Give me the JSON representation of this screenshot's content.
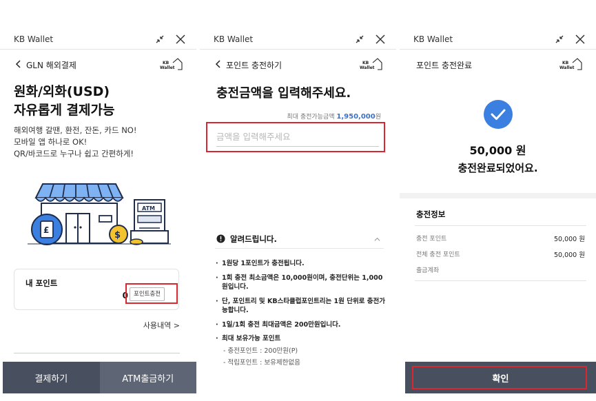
{
  "panel1": {
    "app_title": "KB Wallet",
    "nav_label": "GLN 해외결제",
    "logo_text": [
      "KB",
      "Wallet"
    ],
    "hero_title": [
      "원화/외화(USD)",
      "자유롭게 결제가능"
    ],
    "hero_sub": [
      "해외여행 갈땐, 환전, 잔돈, 카드 NO!",
      "모바일 앱 하나로 OK!",
      "QR/바코드로 누구나 쉽고 간편하게!"
    ],
    "illustration": {
      "atm_label": "ATM",
      "coin_symbol": "$",
      "card_symbol": "£"
    },
    "points_label": "내 포인트",
    "points_value": "0 P",
    "charge_button": "포인트충전",
    "history_link": "사용내역 >",
    "bottom_buttons": {
      "pay": "결제하기",
      "atm": "ATM출금하기"
    }
  },
  "panel2": {
    "app_title": "KB Wallet",
    "nav_label": "포인트 충전하기",
    "title": "충전금액을 입력해주세요.",
    "max_label": "최대 충전가능금액",
    "max_value": "1,950,000",
    "max_unit": "원",
    "amount_placeholder": "금액을 입력해주세요",
    "notice_title": "알려드립니다.",
    "notices": [
      "1원당 1포인트가 충전됩니다.",
      "1회 충전 최소금액은 10,000원이며, 충전단위는 1,000원입니다.",
      "단, 포인트리 및 KB스타클럽포인트리는 1원 단위로 충전가능합니다.",
      "1일/1회 충전 최대금액은 200만원입니다.",
      "최대 보유가능 포인트"
    ],
    "notice_subs": [
      "- 충전포인트 : 200만원(P)",
      "- 적립포인트 : 보유제한없음"
    ]
  },
  "panel3": {
    "app_title": "KB Wallet",
    "nav_label": "포인트 충전완료",
    "amount": "50,000 원",
    "message": "충전완료되었어요.",
    "info_title": "충전정보",
    "info_rows": [
      {
        "label": "충전 포인트",
        "value": "50,000 원"
      },
      {
        "label": "전체 충전 포인트",
        "value": "50,000 원"
      },
      {
        "label": "출금계좌",
        "value": ""
      }
    ],
    "confirm": "확인"
  },
  "colors": {
    "bottom_bar": "#48505f",
    "bottom_bar_alt": "#5e6574",
    "highlight_box": "#d9262f",
    "check_blue": "#3b7fe0",
    "max_amount_blue": "#3d6fc6",
    "awning_blue": "#7fb2f2",
    "illustration_navy": "#1f2d4b"
  },
  "icons": [
    "minimize-icon",
    "close-icon",
    "back-chevron-icon",
    "kb-wallet-logo",
    "info-icon",
    "chevron-up-icon",
    "check-circle-icon",
    "store-illustration"
  ]
}
